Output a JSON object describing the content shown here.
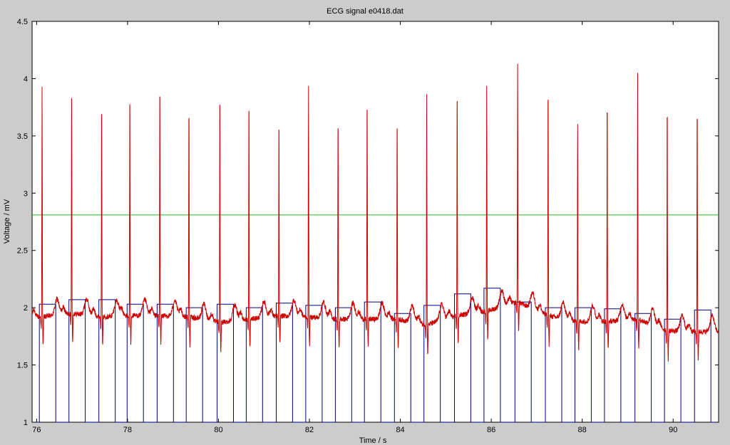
{
  "window": {
    "background_color": "#cccccc"
  },
  "chart_data": {
    "type": "line",
    "title": "ECG signal e0418.dat",
    "xlabel": "Time / s",
    "ylabel": "Voltage / mV",
    "xlim": [
      75.9,
      91.0
    ],
    "ylim": [
      1,
      4.5
    ],
    "xticks": [
      76,
      78,
      80,
      82,
      84,
      86,
      88,
      90
    ],
    "xtick_labels": [
      "76",
      "78",
      "80",
      "82",
      "84",
      "86",
      "88",
      "90"
    ],
    "yticks": [
      1,
      1.5,
      2,
      2.5,
      3,
      3.5,
      4,
      4.5
    ],
    "ytick_labels": [
      "1",
      "1.5",
      "2",
      "2.5",
      "3",
      "3.5",
      "4",
      "4.5"
    ],
    "grid": false,
    "colors": {
      "ecg": "#cc0000",
      "threshold": "#22bb22",
      "markers": "#000080"
    },
    "threshold": {
      "y": 2.81
    },
    "r_peaks": {
      "t": [
        76.12,
        76.77,
        77.43,
        78.05,
        78.71,
        79.35,
        80.03,
        80.67,
        81.33,
        81.98,
        82.63,
        83.27,
        83.93,
        84.58,
        85.25,
        85.9,
        86.58,
        87.25,
        87.9,
        88.55,
        89.22,
        89.87,
        90.53
      ],
      "amp": [
        3.92,
        4.02,
        3.89,
        3.95,
        4.02,
        3.83,
        3.95,
        3.9,
        3.73,
        3.92,
        3.72,
        3.92,
        3.73,
        3.85,
        4.0,
        3.95,
        4.15,
        4.0,
        3.62,
        3.88,
        4.07,
        3.83,
        3.83
      ]
    },
    "pulse_levels": [
      2.03,
      2.07,
      2.07,
      2.03,
      2.03,
      2.0,
      2.03,
      2.0,
      2.04,
      2.02,
      2.0,
      2.05,
      1.95,
      2.02,
      2.12,
      2.17,
      2.05,
      2.0,
      2.0,
      1.99,
      1.95,
      1.9,
      1.98
    ],
    "baseline_levels": [
      1.92,
      1.95,
      1.92,
      1.93,
      1.93,
      1.92,
      1.87,
      1.9,
      1.93,
      1.92,
      1.9,
      1.9,
      1.9,
      1.85,
      1.93,
      1.97,
      2.05,
      1.93,
      1.88,
      1.88,
      1.9,
      1.8,
      1.79
    ]
  }
}
